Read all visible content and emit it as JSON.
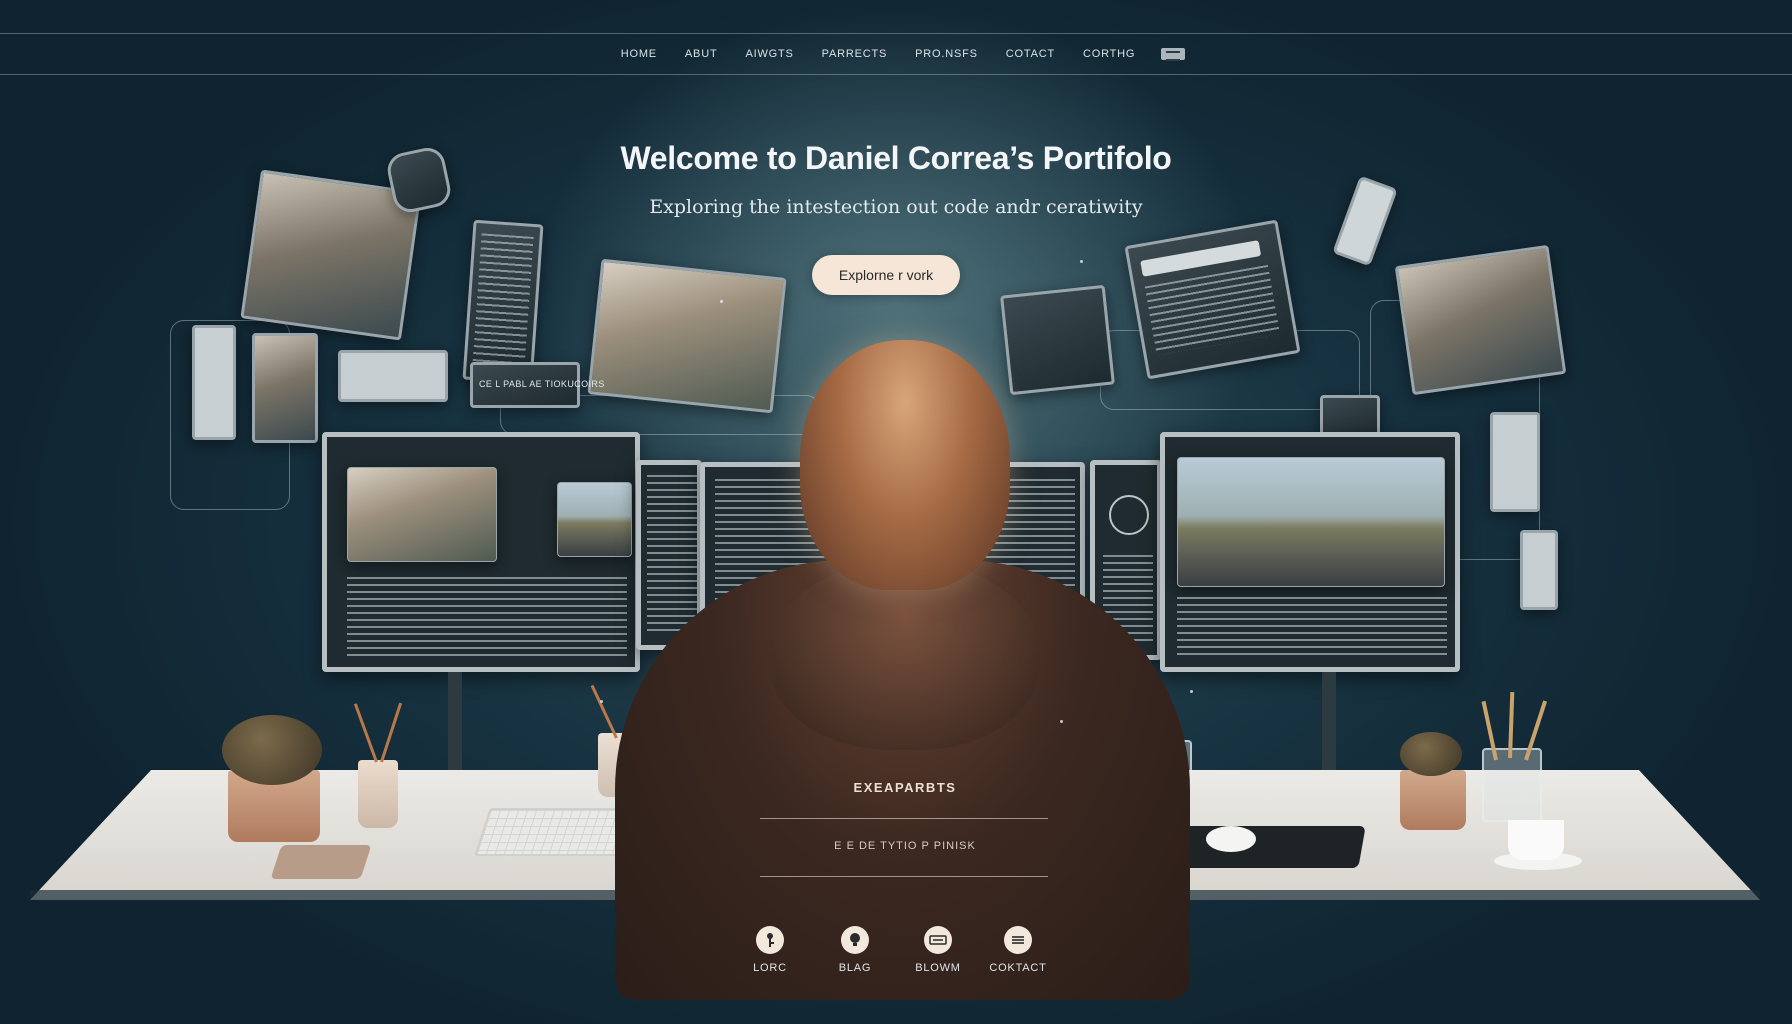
{
  "nav": {
    "items": [
      "HOME",
      "ABUT",
      "AIWGTS",
      "PARRECTS",
      "PRO.NSFS",
      "COTACT",
      "CORTHG"
    ],
    "menu_icon": "menu-icon"
  },
  "hero": {
    "title": "Welcome to Daniel Correa’s Portifolo",
    "subtitle": "Exploring the intestection out code andr ceratiwity",
    "cta_label": "Explorne r vork"
  },
  "hoodie": {
    "title": "EXEAPARBTS",
    "text": "E E DE TYTIO P PINISK"
  },
  "panel_caption": "CE L PABL AE TIOKUCOIRS",
  "footer": {
    "links": [
      {
        "label": "LORC",
        "icon": "key-icon"
      },
      {
        "label": "BLAG",
        "icon": "lightbulb-icon"
      },
      {
        "label": "BLOWM",
        "icon": "keyboard-icon"
      },
      {
        "label": "COKTACT",
        "icon": "chat-icon"
      }
    ]
  },
  "colors": {
    "background": "#10222c",
    "cta_background": "#f5e6d8",
    "footer_icon": "#f2e9dc"
  }
}
